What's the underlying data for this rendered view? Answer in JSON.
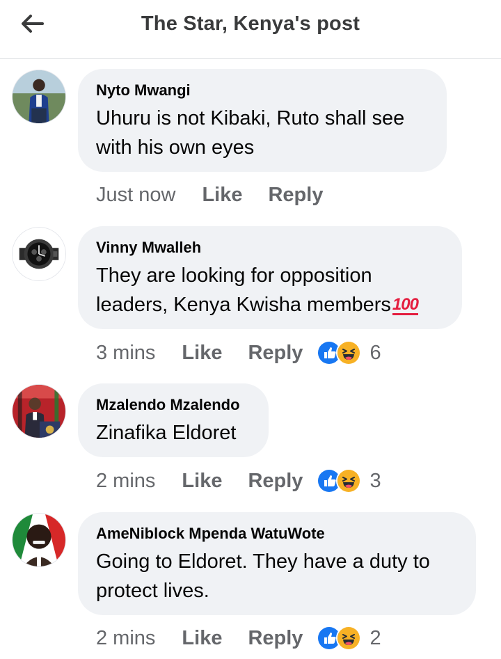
{
  "header": {
    "title": "The Star, Kenya's post",
    "back_icon": "arrow-left-icon"
  },
  "colors": {
    "bubble": "#f0f2f5",
    "meta_text": "#65676b",
    "like_blue": "#1877f2",
    "haha_yellow": "#f7b125"
  },
  "comments": [
    {
      "author": "Nyto Mwangi",
      "text": "Uhuru is not Kibaki, Ruto shall see with his own eyes",
      "time": "Just now",
      "like_label": "Like",
      "reply_label": "Reply",
      "reaction_count": ""
    },
    {
      "author": "Vinny Mwalleh",
      "text": "They are looking for opposition leaders, Kenya Kwisha members",
      "emoji": "100",
      "time": "3 mins",
      "like_label": "Like",
      "reply_label": "Reply",
      "reactions": [
        "like-icon",
        "haha-icon"
      ],
      "reaction_count": "6"
    },
    {
      "author": "Mzalendo Mzalendo",
      "text": "Zinafika Eldoret",
      "time": "2 mins",
      "like_label": "Like",
      "reply_label": "Reply",
      "reactions": [
        "like-icon",
        "haha-icon"
      ],
      "reaction_count": "3"
    },
    {
      "author": "AmeNiblock Mpenda WatuWote",
      "text": "Going to Eldoret. They have a duty to protect lives.",
      "time": "2 mins",
      "like_label": "Like",
      "reply_label": "Reply",
      "reactions": [
        "like-icon",
        "haha-icon"
      ],
      "reaction_count": "2"
    }
  ]
}
